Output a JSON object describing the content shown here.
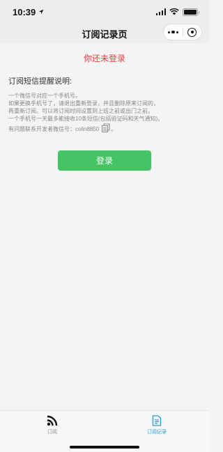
{
  "status_bar": {
    "time": "10:39",
    "location_icon": "location-arrow-icon",
    "icons": [
      "signal-icon",
      "wifi-icon",
      "battery-icon"
    ]
  },
  "nav": {
    "title": "订阅记录页",
    "capsule_icons": [
      "more-icon",
      "close-target-icon"
    ]
  },
  "main": {
    "login_warning": "你还未登录",
    "notice_title": "订阅短信提醒说明:",
    "notice_lines": [
      "一个微信号对应一个手机号。",
      "如果更换手机号了，请退出重新登录，并且删除原来订阅的，",
      "再重新订阅。可以将订阅时间设置到上班之前或出门之前。",
      "一个手机号一天最多能接收10条短信(包括验证码和天气通知)。"
    ],
    "contact_text": "有问题联系开发者微信号：colin8850",
    "contact_suffix": "。",
    "login_button": "登录"
  },
  "tab_bar": {
    "tabs": [
      {
        "label": "订阅",
        "icon": "rss-feed-icon",
        "active": false
      },
      {
        "label": "订阅记录",
        "icon": "document-icon",
        "active": true
      }
    ]
  },
  "colors": {
    "accent_green": "#45c365",
    "warning_red": "#e64340",
    "active_tab_blue": "#2a9ad6"
  }
}
